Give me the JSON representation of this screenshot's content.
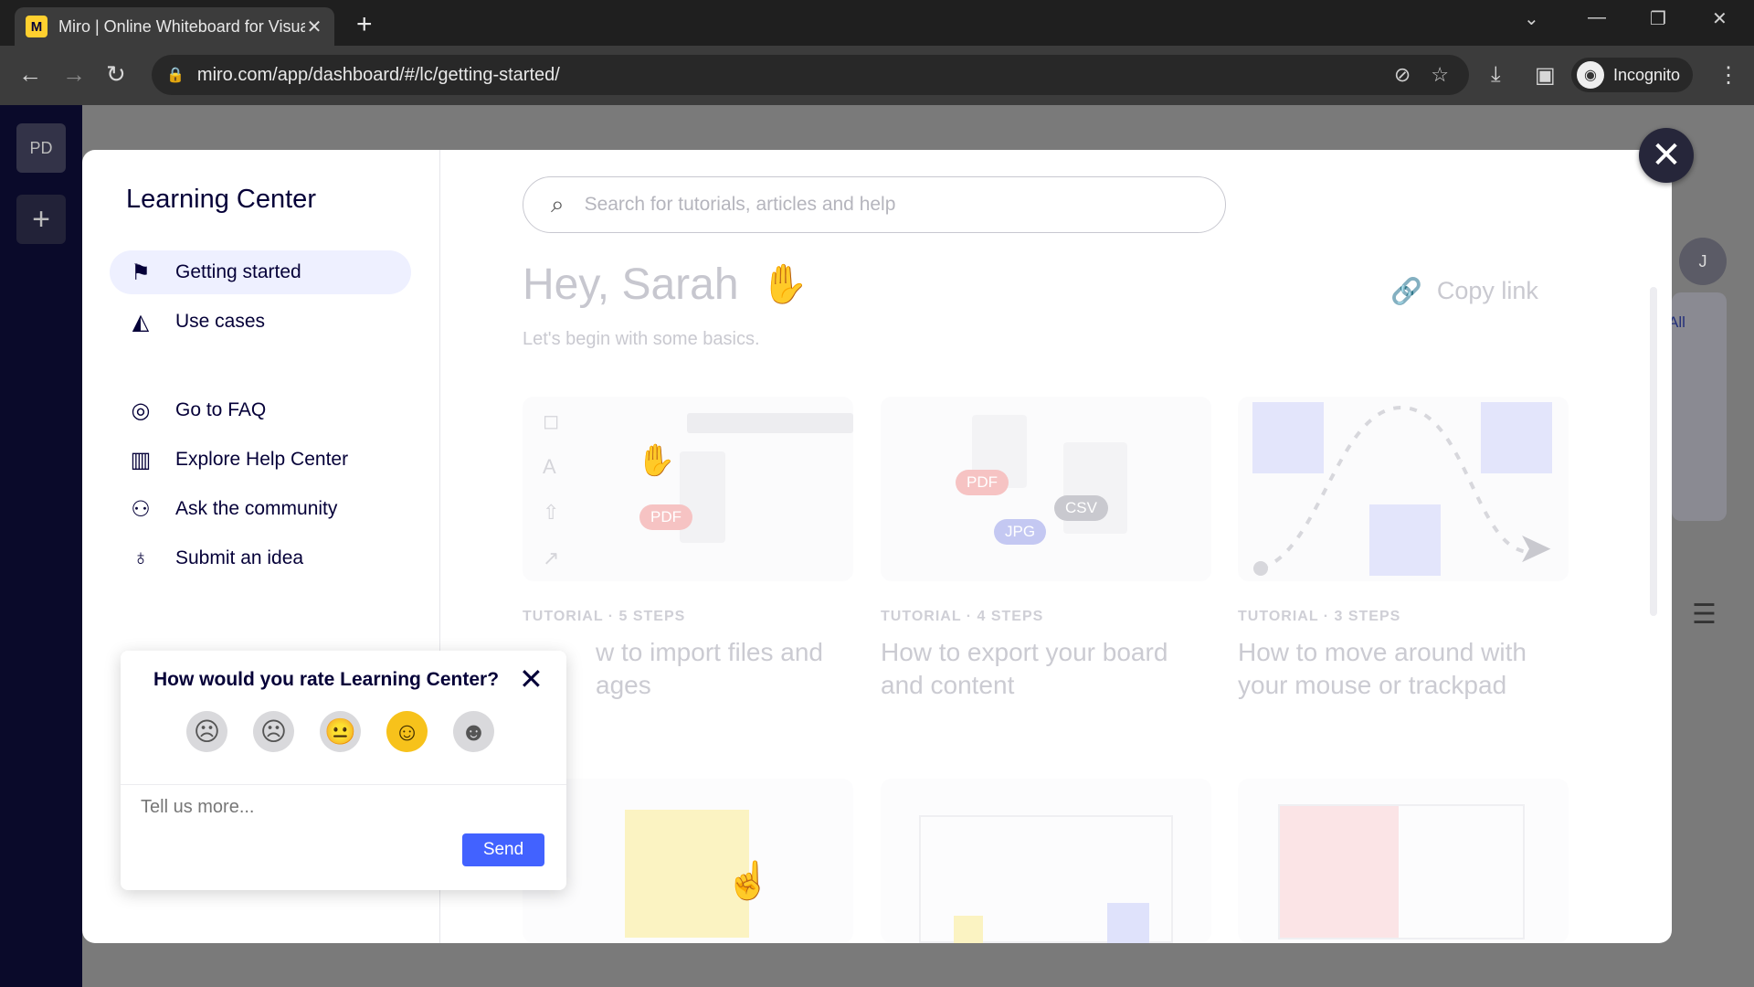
{
  "browser": {
    "tab_title": "Miro | Online Whiteboard for Visual Collaboration",
    "tab_favicon": "M",
    "new_tab": "+",
    "url": "miro.com/app/dashboard/#/lc/getting-started/",
    "incognito_label": "Incognito"
  },
  "background": {
    "workspace_initials": "PD",
    "user_initial": "J",
    "all_label": "All"
  },
  "learning_center": {
    "title": "Learning Center",
    "nav": [
      {
        "label": "Getting started",
        "icon": "flag-icon",
        "active": true
      },
      {
        "label": "Use cases",
        "icon": "shapes-icon"
      },
      {
        "label": "Go to FAQ",
        "icon": "lifebuoy-icon"
      },
      {
        "label": "Explore Help Center",
        "icon": "book-icon"
      },
      {
        "label": "Ask the community",
        "icon": "people-icon"
      },
      {
        "label": "Submit an idea",
        "icon": "lightbulb-icon"
      }
    ],
    "search_placeholder": "Search for tutorials, articles and help",
    "greeting": "Hey, Sarah",
    "subtitle": "Let's begin with some basics.",
    "copy_link": "Copy link",
    "cards": [
      {
        "meta": "TUTORIAL · 5 STEPS",
        "title": "How to import files and images",
        "title_visible": "w to import files and\nages"
      },
      {
        "meta": "TUTORIAL · 4 STEPS",
        "title": "How to export your board and content"
      },
      {
        "meta": "TUTORIAL · 3 STEPS",
        "title": "How to move around with your mouse or trackpad"
      }
    ],
    "tags": {
      "pdf": "PDF",
      "jpg": "JPG",
      "csv": "CSV"
    }
  },
  "rating": {
    "question": "How would you rate Learning Center?",
    "options": [
      "angry",
      "sad",
      "neutral",
      "happy",
      "love"
    ],
    "selected": "happy",
    "placeholder": "Tell us more...",
    "send_label": "Send"
  },
  "colors": {
    "accent": "#4262ff",
    "brand_yellow": "#ffd02f",
    "text_dark": "#050038"
  }
}
